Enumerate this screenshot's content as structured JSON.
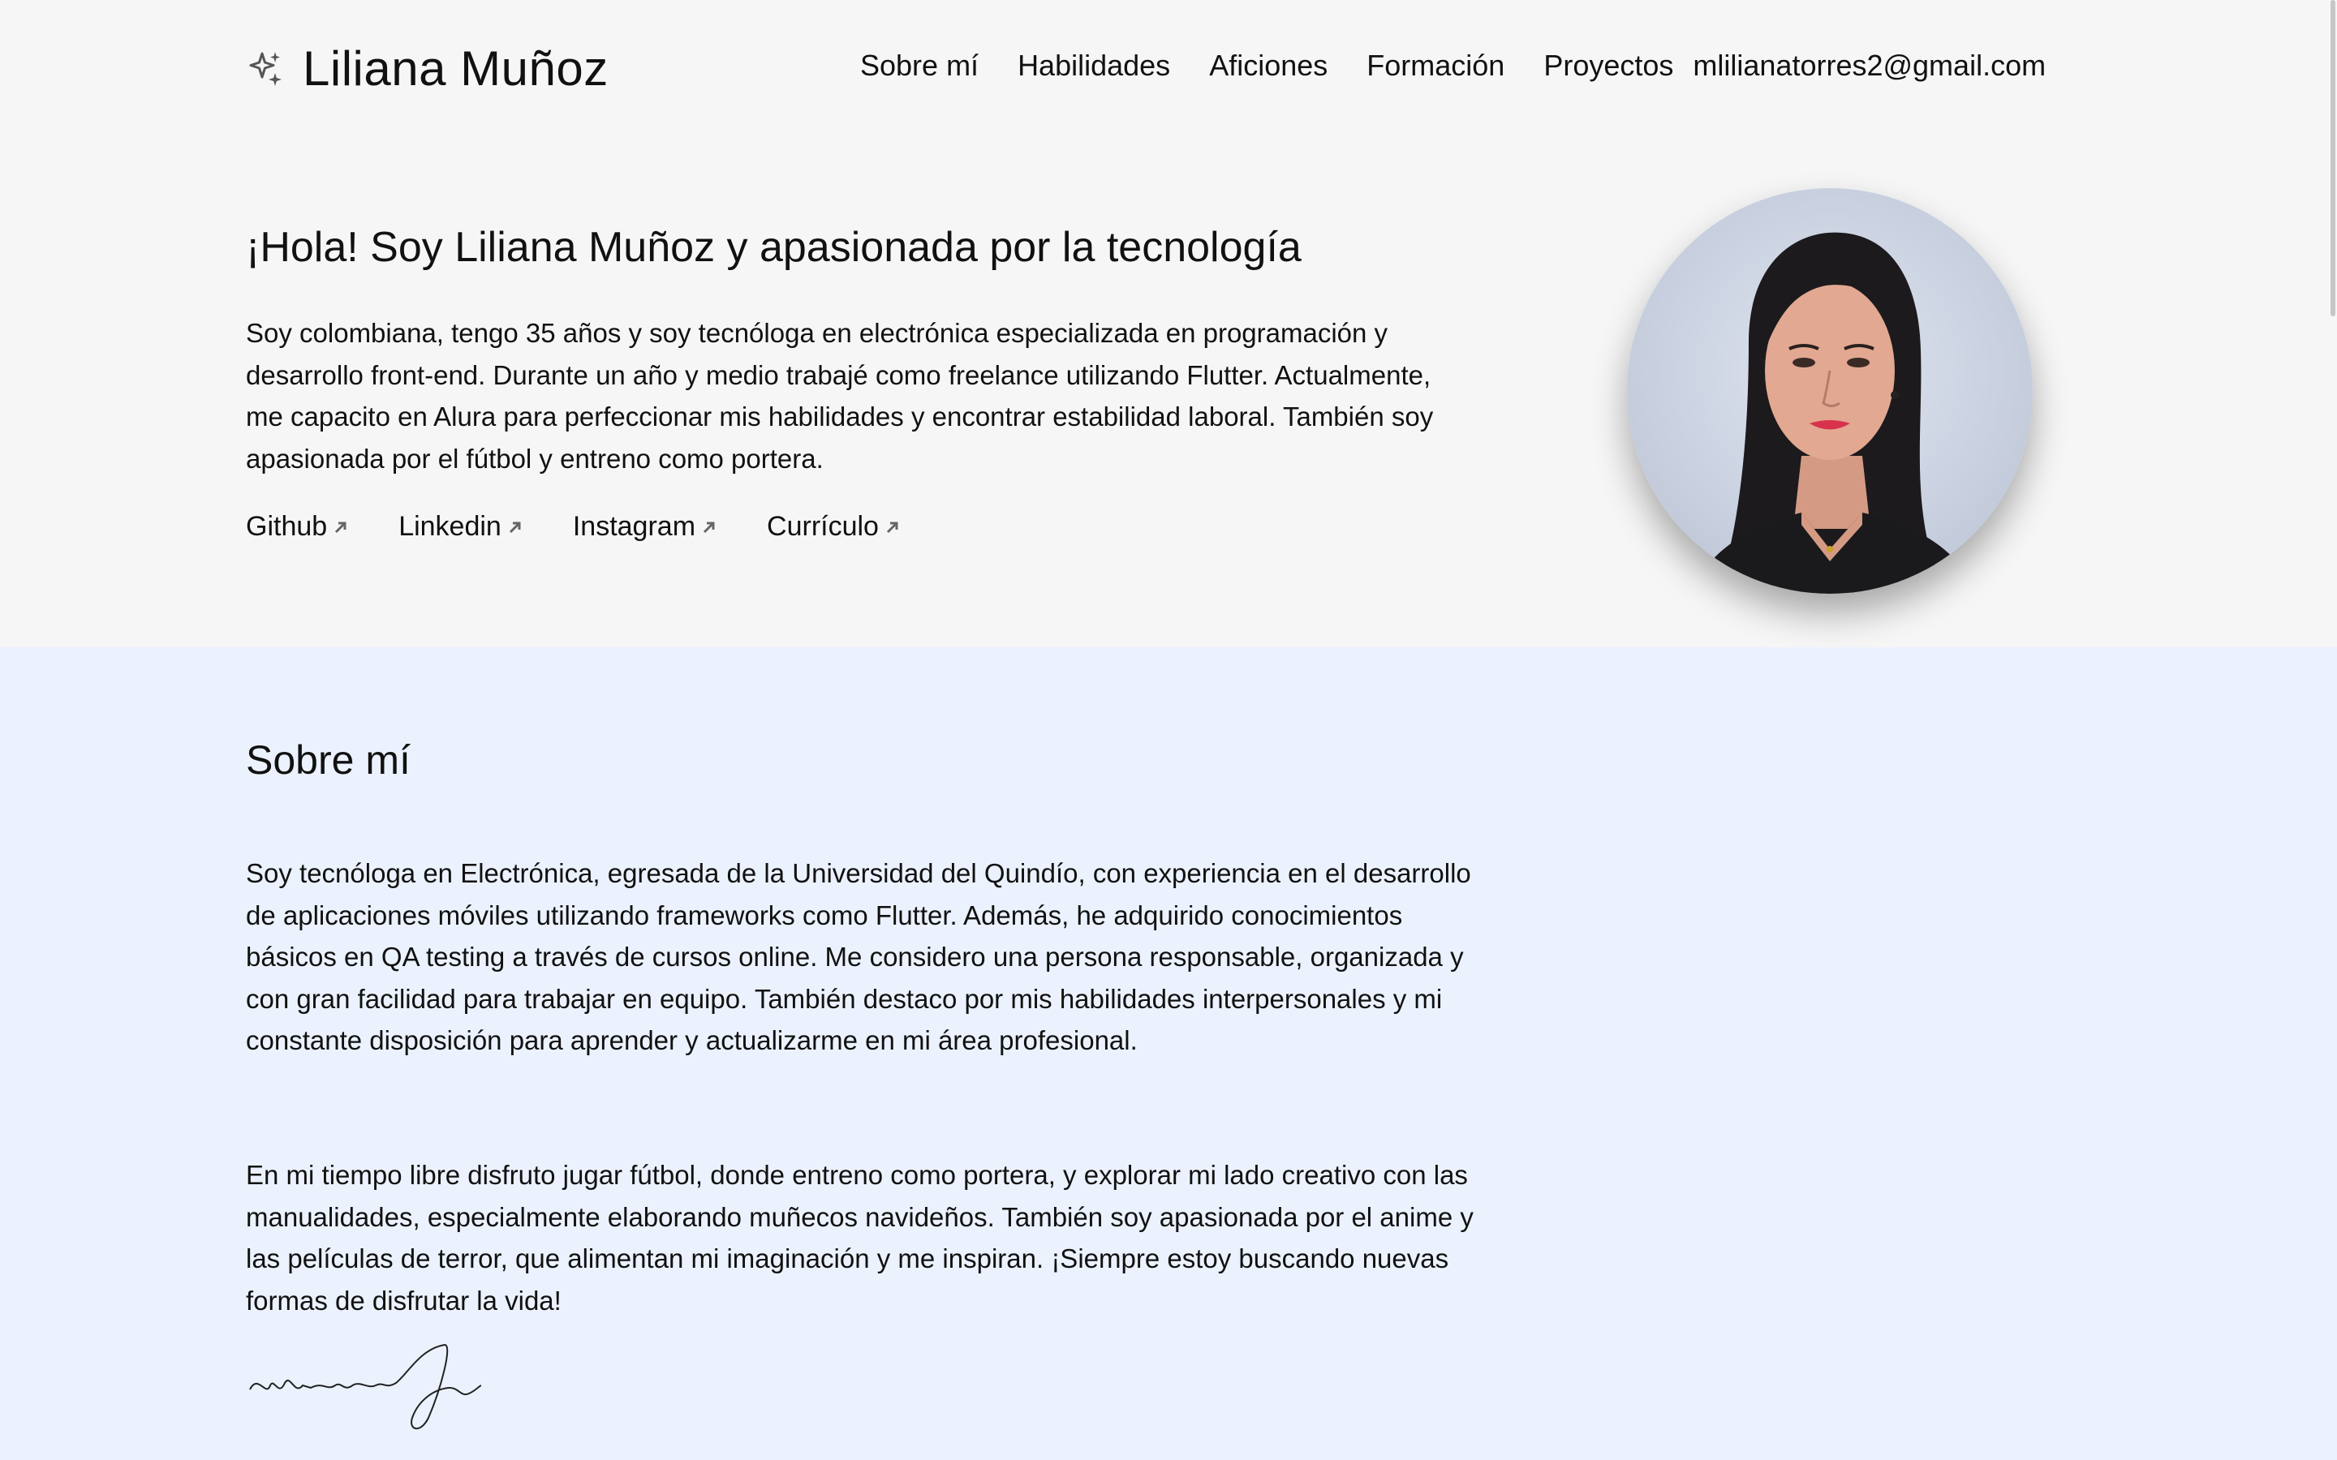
{
  "header": {
    "brand_name": "Liliana Muñoz",
    "nav": [
      "Sobre mí",
      "Habilidades",
      "Aficiones",
      "Formación",
      "Proyectos"
    ],
    "email": "mlilianatorres2@gmail.com"
  },
  "hero": {
    "title": "¡Hola! Soy Liliana Muñoz y apasionada por la tecnología",
    "text": "Soy colombiana, tengo 35 años y soy tecnóloga en electrónica especializada en programación y desarrollo front-end. Durante un año y medio trabajé como freelance utilizando Flutter. Actualmente, me capacito en Alura para perfeccionar mis habilidades y encontrar estabilidad laboral. También soy apasionada por el fútbol y entreno como portera.",
    "links": [
      "Github",
      "Linkedin",
      "Instagram",
      "Currículo"
    ]
  },
  "about": {
    "title": "Sobre mí",
    "p1": "Soy tecnóloga en Electrónica, egresada de la Universidad del Quindío, con experiencia en el desarrollo de aplicaciones móviles utilizando frameworks como Flutter. Además, he adquirido conocimientos básicos en QA testing a través de cursos online. Me considero una persona responsable, organizada y con gran facilidad para trabajar en equipo. También destaco por mis habilidades interpersonales y mi constante disposición para aprender y actualizarme en mi área profesional.",
    "p2": "En mi tiempo libre disfruto jugar fútbol, donde entreno como portera, y explorar mi lado creativo con las manualidades, especialmente elaborando muñecos navideños. También soy apasionada por el anime y las películas de terror, que alimentan mi imaginación y me inspiran. ¡Siempre estoy buscando nuevas formas de disfrutar la vida!"
  },
  "colors": {
    "page_bg": "#f6f6f6",
    "about_bg": "#ebf2fd",
    "text": "#111111"
  },
  "icons": [
    "sparkle-icon",
    "external-link-arrow-icon",
    "signature"
  ]
}
